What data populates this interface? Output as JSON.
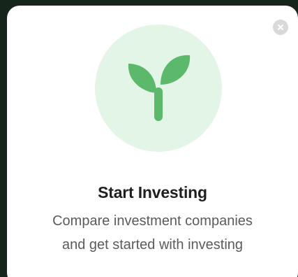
{
  "card": {
    "title": "Start Investing",
    "subtitle_line1": "Compare investment companies",
    "subtitle_line2": "and get started with investing",
    "illustration_icon": "sprout-icon",
    "close_icon": "close-icon"
  },
  "colors": {
    "background": "#15251c",
    "card": "#ffffff",
    "illustration_bg": "#e3f5e7",
    "sprout": "#5cb86a",
    "close_bg": "#d9d9d9",
    "title": "#1f1f1f",
    "subtitle": "#5b5b5b"
  }
}
